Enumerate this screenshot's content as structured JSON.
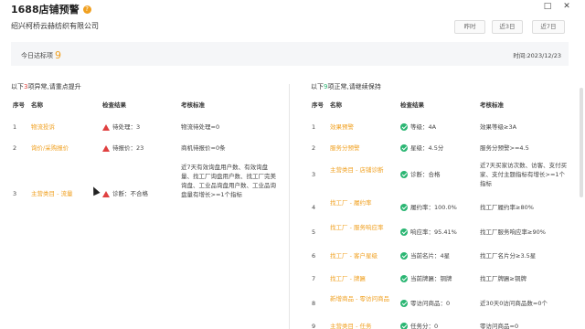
{
  "window": {
    "title": "1688店铺预警",
    "help_icon": "?",
    "maximize_icon": "□",
    "close_icon": "✕"
  },
  "company": "绍兴柯桥云赫纺织有限公司",
  "time_filters": [
    "昨时",
    "近3日",
    "近7日"
  ],
  "summary": {
    "label": "今日达标项",
    "count": "9",
    "time": "时间:2023/12/23"
  },
  "left": {
    "title_prefix": "以下",
    "count": "3",
    "title_suffix": "项异常,请重点提升",
    "headers": [
      "序号",
      "名称",
      "检查结果",
      "考核标准"
    ],
    "rows": [
      {
        "no": "1",
        "name": "物流投诉",
        "result": "待处理：3",
        "standard": "物流待处理=0"
      },
      {
        "no": "2",
        "name": "询价/采购报价",
        "result": "待报价：23",
        "standard": "商机待报价=0条"
      },
      {
        "no": "3",
        "name": "主营类目 - 流量",
        "result": "诊断：不合格",
        "standard": "近7天有效询盘用户数、有效询盘量、找工厂询盘用户数、找工厂完美询盘、工业品询盘用户数、工业品询盘量有增长>=1个指标"
      }
    ]
  },
  "right": {
    "title_prefix": "以下",
    "count": "9",
    "title_suffix": "项正常,请继续保持",
    "headers": [
      "序号",
      "名称",
      "检查结果",
      "考核标准"
    ],
    "rows": [
      {
        "no": "1",
        "name": "效果预警",
        "result": "等级：4A",
        "standard": "效果等级≥3A"
      },
      {
        "no": "2",
        "name": "服务分预警",
        "result": "星级：4.5分",
        "standard": "服务分预警>=4.5"
      },
      {
        "no": "3",
        "name": "主营类目 - 店铺诊断",
        "result": "诊断：合格",
        "standard": "近7天买家访次数、访客、支付买家、支付主题指标有增长>=1个指标"
      },
      {
        "no": "4",
        "name": "找工厂 - 履约率",
        "result": "履约率：100.0%",
        "standard": "找工厂履约率≥80%"
      },
      {
        "no": "5",
        "name": "找工厂 - 服务响应率",
        "result": "响应率：95.41%",
        "standard": "找工厂服务响应率≥90%"
      },
      {
        "no": "6",
        "name": "找工厂 - 客户星级",
        "result": "当前名片：4星",
        "standard": "找工厂名片分≥3.5星"
      },
      {
        "no": "7",
        "name": "找工厂 - 牌匾",
        "result": "当前牌匾：铜牌",
        "standard": "找工厂牌匾≥铜牌"
      },
      {
        "no": "8",
        "name": "新增商品 - 零访问商品",
        "result": "零访问商品：0",
        "standard": "近30天0访问商品数=0个"
      },
      {
        "no": "9",
        "name": "主营类目 - 任务",
        "result": "任务分：0",
        "standard": "零访问商品=0"
      }
    ]
  }
}
